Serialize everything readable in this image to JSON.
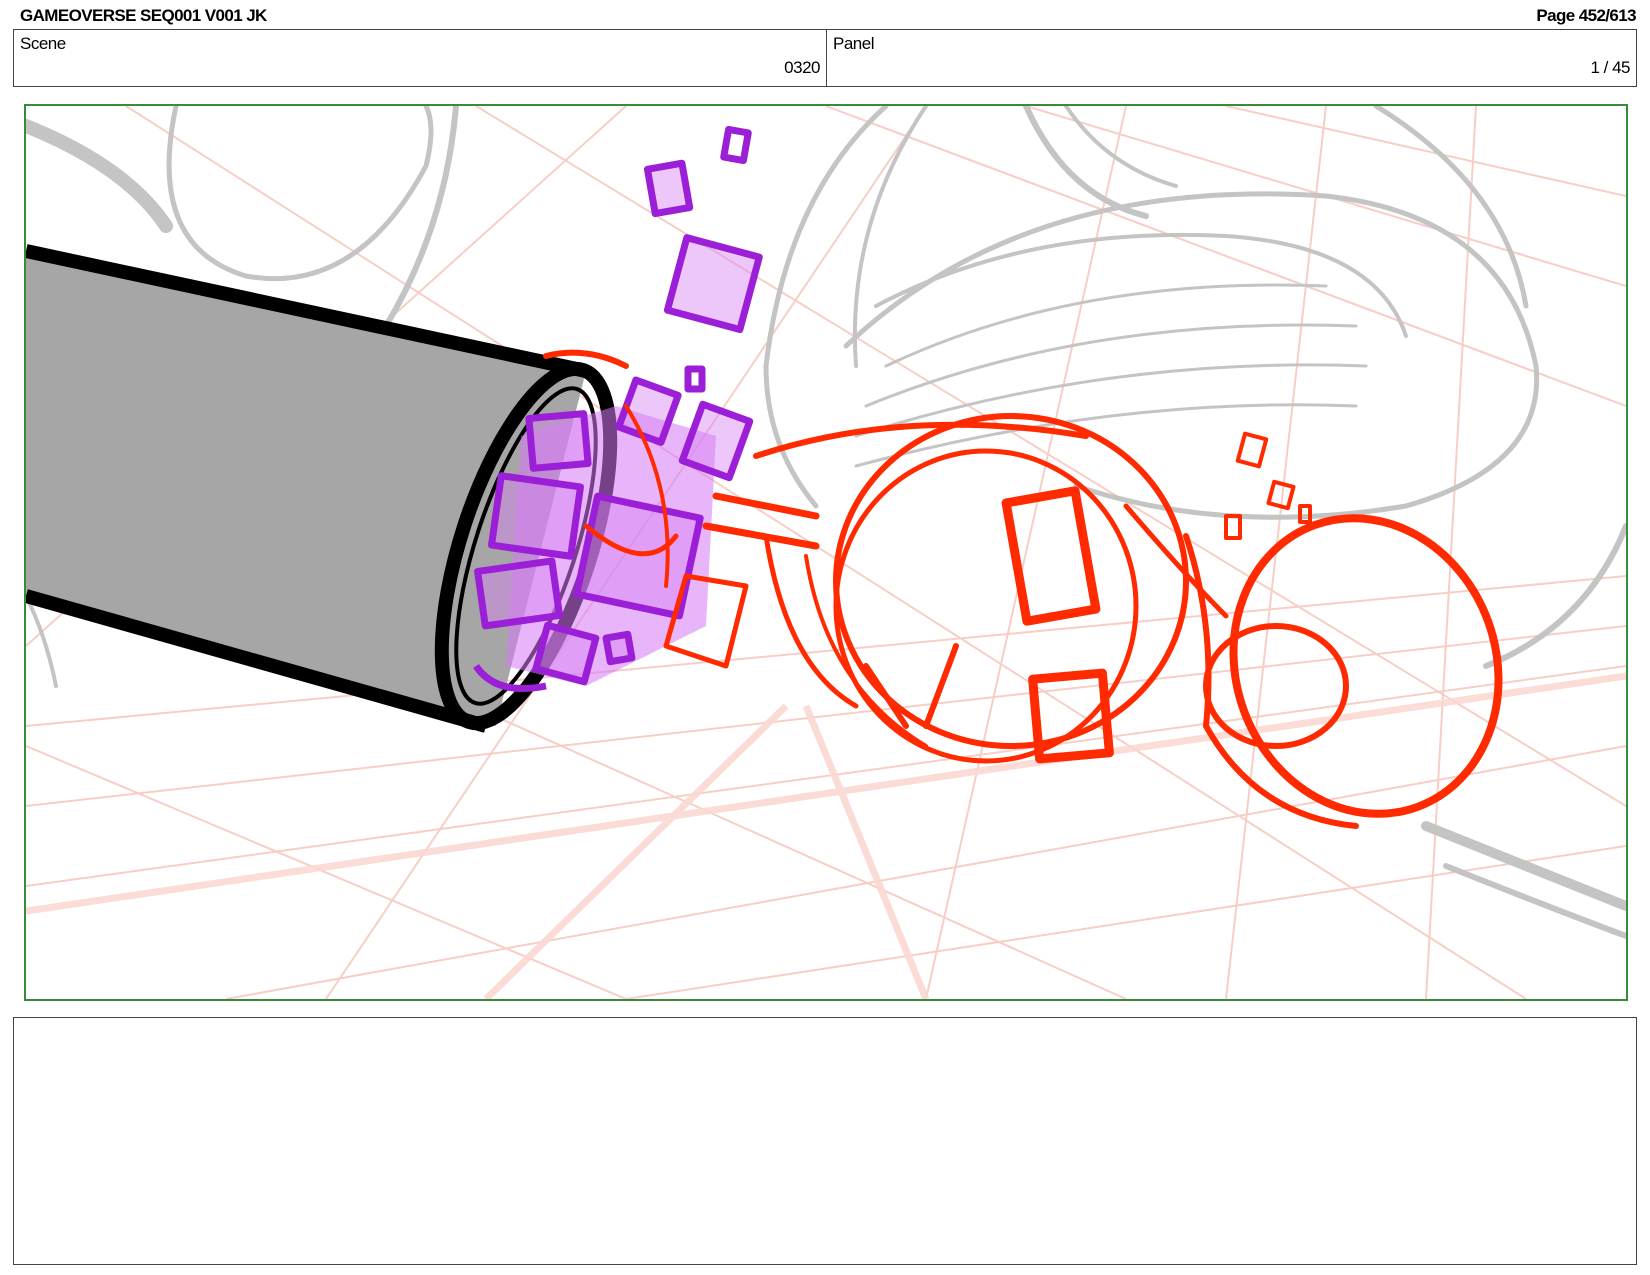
{
  "header": {
    "title": "GAMEOVERSE SEQ001 V001 JK",
    "page": "Page 452/613"
  },
  "info": {
    "scene_label": "Scene",
    "scene_value": "0320",
    "panel_label": "Panel",
    "panel_value": "1 / 45"
  },
  "notes": {
    "text": ""
  },
  "colors": {
    "frame_border": "#3a8a3a",
    "red_sketch": "#ff2a00",
    "purple_blocks": "#9b1fd6",
    "grid_lines": "#f7c9c0",
    "grey_sketch": "#c8c8c8"
  }
}
